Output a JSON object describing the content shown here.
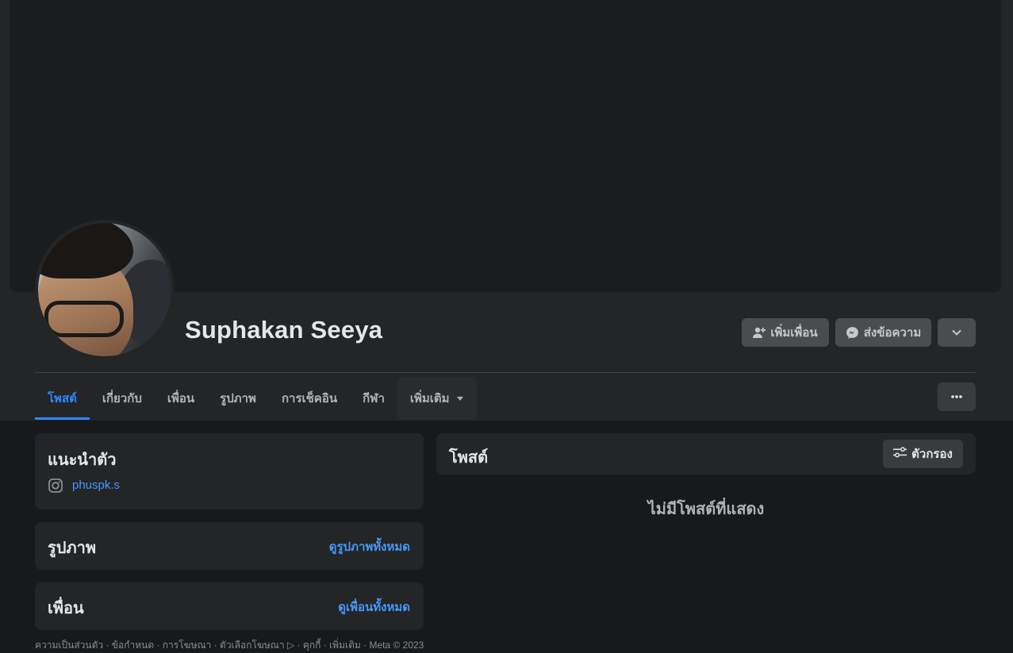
{
  "profile": {
    "name": "Suphakan Seeya"
  },
  "actions": {
    "add_friend_label": "เพิ่มเพื่อน",
    "message_label": "ส่งข้อความ",
    "dropdown_icon": "chevron-down-icon",
    "more_icon": "more-dots-icon"
  },
  "tabs": [
    {
      "label": "โพสต์",
      "active": true
    },
    {
      "label": "เกี่ยวกับ"
    },
    {
      "label": "เพื่อน"
    },
    {
      "label": "รูปภาพ"
    },
    {
      "label": "การเช็คอิน"
    },
    {
      "label": "กีฬา"
    },
    {
      "label": "เพิ่มเติม"
    }
  ],
  "intro": {
    "title": "แนะนำตัว",
    "instagram": "phuspk.s"
  },
  "photos": {
    "title": "รูปภาพ",
    "see_all": "ดูรูปภาพทั้งหมด"
  },
  "friends": {
    "title": "เพื่อน",
    "see_all": "ดูเพื่อนทั้งหมด"
  },
  "posts": {
    "title": "โพสต์",
    "filter_label": "ตัวกรอง",
    "empty": "ไม่มีโพสต์ที่แสดง"
  },
  "footer": {
    "text": "ความเป็นส่วนตัว · ข้อกำหนด · การโฆษณา · ตัวเลือกโฆษณา ▷ · คุกกี้ · เพิ่มเติม · Meta © 2023"
  },
  "colors": {
    "accent": "#2d88ff",
    "link": "#4599ff",
    "background": "#18191a",
    "surface": "#242526"
  }
}
